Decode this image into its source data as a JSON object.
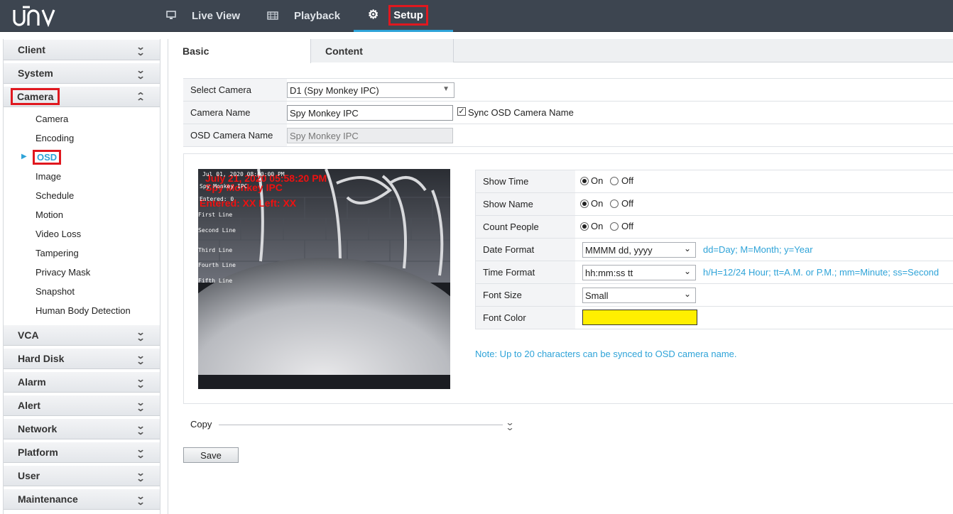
{
  "app": {
    "logo": "UNV"
  },
  "topnav": {
    "live_view": "Live View",
    "playback": "Playback",
    "setup": "Setup"
  },
  "sidebar": {
    "sections_top": [
      {
        "label": "Client"
      },
      {
        "label": "System"
      }
    ],
    "open_section": "Camera",
    "items": [
      "Camera",
      "Encoding",
      "OSD",
      "Image",
      "Schedule",
      "Motion",
      "Video Loss",
      "Tampering",
      "Privacy Mask",
      "Snapshot",
      "Human Body Detection"
    ],
    "active_item": "OSD",
    "sections_bottom": [
      {
        "label": "VCA"
      },
      {
        "label": "Hard Disk"
      },
      {
        "label": "Alarm"
      },
      {
        "label": "Alert"
      },
      {
        "label": "Network"
      },
      {
        "label": "Platform"
      },
      {
        "label": "User"
      },
      {
        "label": "Maintenance"
      }
    ]
  },
  "tabs": {
    "basic": "Basic",
    "content": "Content"
  },
  "form": {
    "select_camera_label": "Select Camera",
    "select_camera_value": "D1 (Spy Monkey IPC)",
    "camera_name_label": "Camera Name",
    "camera_name_value": "Spy Monkey IPC",
    "sync_osd_label": "Sync OSD Camera Name",
    "osd_camera_name_label": "OSD Camera Name",
    "osd_camera_name_value": "Spy Monkey IPC"
  },
  "preview": {
    "time_overlay": "July 21, 2020 05:58:20 PM",
    "name_overlay": "Spy Monkey IPC",
    "count_overlay": "Entered: XX Left: XX",
    "small_date": "Jul 01, 2020 08:00:00 PM",
    "small_name": "Spy Monkey IPC",
    "small_count": "Entered:   0",
    "lines": [
      "First Line",
      "Second Line",
      "Third Line",
      "Fourth Line",
      "Fifth Line"
    ]
  },
  "osd_settings": {
    "show_time_label": "Show Time",
    "show_name_label": "Show Name",
    "count_people_label": "Count People",
    "on_label": "On",
    "off_label": "Off",
    "date_format_label": "Date Format",
    "date_format_value": "MMMM dd, yyyy",
    "date_format_hint": "dd=Day; M=Month; y=Year",
    "time_format_label": "Time Format",
    "time_format_value": "hh:mm:ss tt",
    "time_format_hint": "h/H=12/24 Hour; tt=A.M. or P.M.; mm=Minute; ss=Second",
    "font_size_label": "Font Size",
    "font_size_value": "Small",
    "font_color_label": "Font Color",
    "font_color_value": "#ffef00",
    "note": "Note: Up to 20 characters can be synced to OSD camera name."
  },
  "copy_label": "Copy",
  "save_label": "Save",
  "colors": {
    "accent": "#2ea3d8",
    "highlight": "#e0181f",
    "topbar": "#3d4550"
  }
}
